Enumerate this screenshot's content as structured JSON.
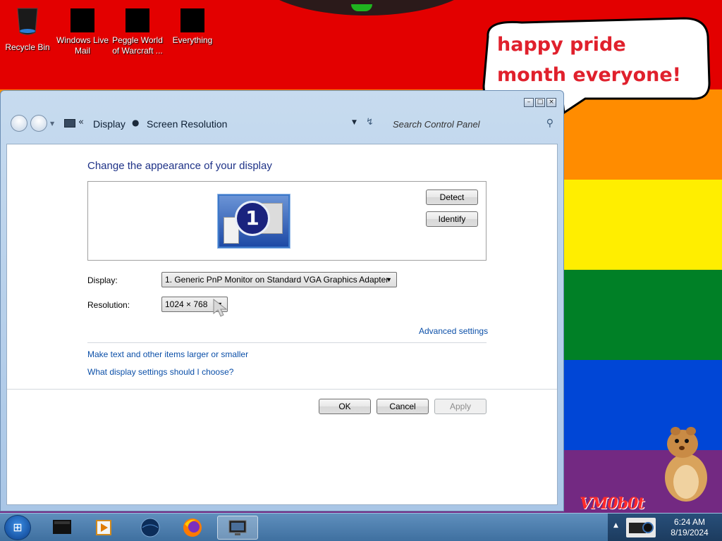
{
  "desktop": {
    "speech_text": "happy pride month everyone!",
    "watermark": "VM0b0t",
    "icons": [
      {
        "label": "Recycle Bin",
        "icon": "recycle-bin-icon"
      },
      {
        "label": "Windows Live Mail",
        "icon": "mail-icon"
      },
      {
        "label": "Peggle World of Warcraft ...",
        "icon": "peggle-icon"
      },
      {
        "label": "Everything",
        "icon": "search-app-icon"
      }
    ]
  },
  "window": {
    "breadcrumb": [
      "Display",
      "Screen Resolution"
    ],
    "search_placeholder": "Search Control Panel",
    "page_title": "Change the appearance of your display",
    "monitor_number": "1",
    "detect_label": "Detect",
    "identify_label": "Identify",
    "display_label": "Display:",
    "display_value": "1. Generic PnP Monitor on Standard VGA Graphics Adapter",
    "resolution_label": "Resolution:",
    "resolution_value": "1024 × 768",
    "advanced_link": "Advanced settings",
    "link_text_size": "Make text and other items larger or smaller",
    "link_help": "What display settings should I choose?",
    "ok_label": "OK",
    "cancel_label": "Cancel",
    "apply_label": "Apply"
  },
  "taskbar": {
    "time": "6:24 AM",
    "date": "8/19/2024",
    "apps": [
      "file-explorer-icon",
      "media-player-icon",
      "browser-globe-icon",
      "firefox-icon",
      "display-settings-icon"
    ]
  },
  "colors": {
    "rainbow": [
      "#e30000",
      "#ff8c00",
      "#ffee00",
      "#008026",
      "#0046d6",
      "#732982"
    ],
    "link": "#0b4fa8",
    "title": "#1e3287"
  }
}
